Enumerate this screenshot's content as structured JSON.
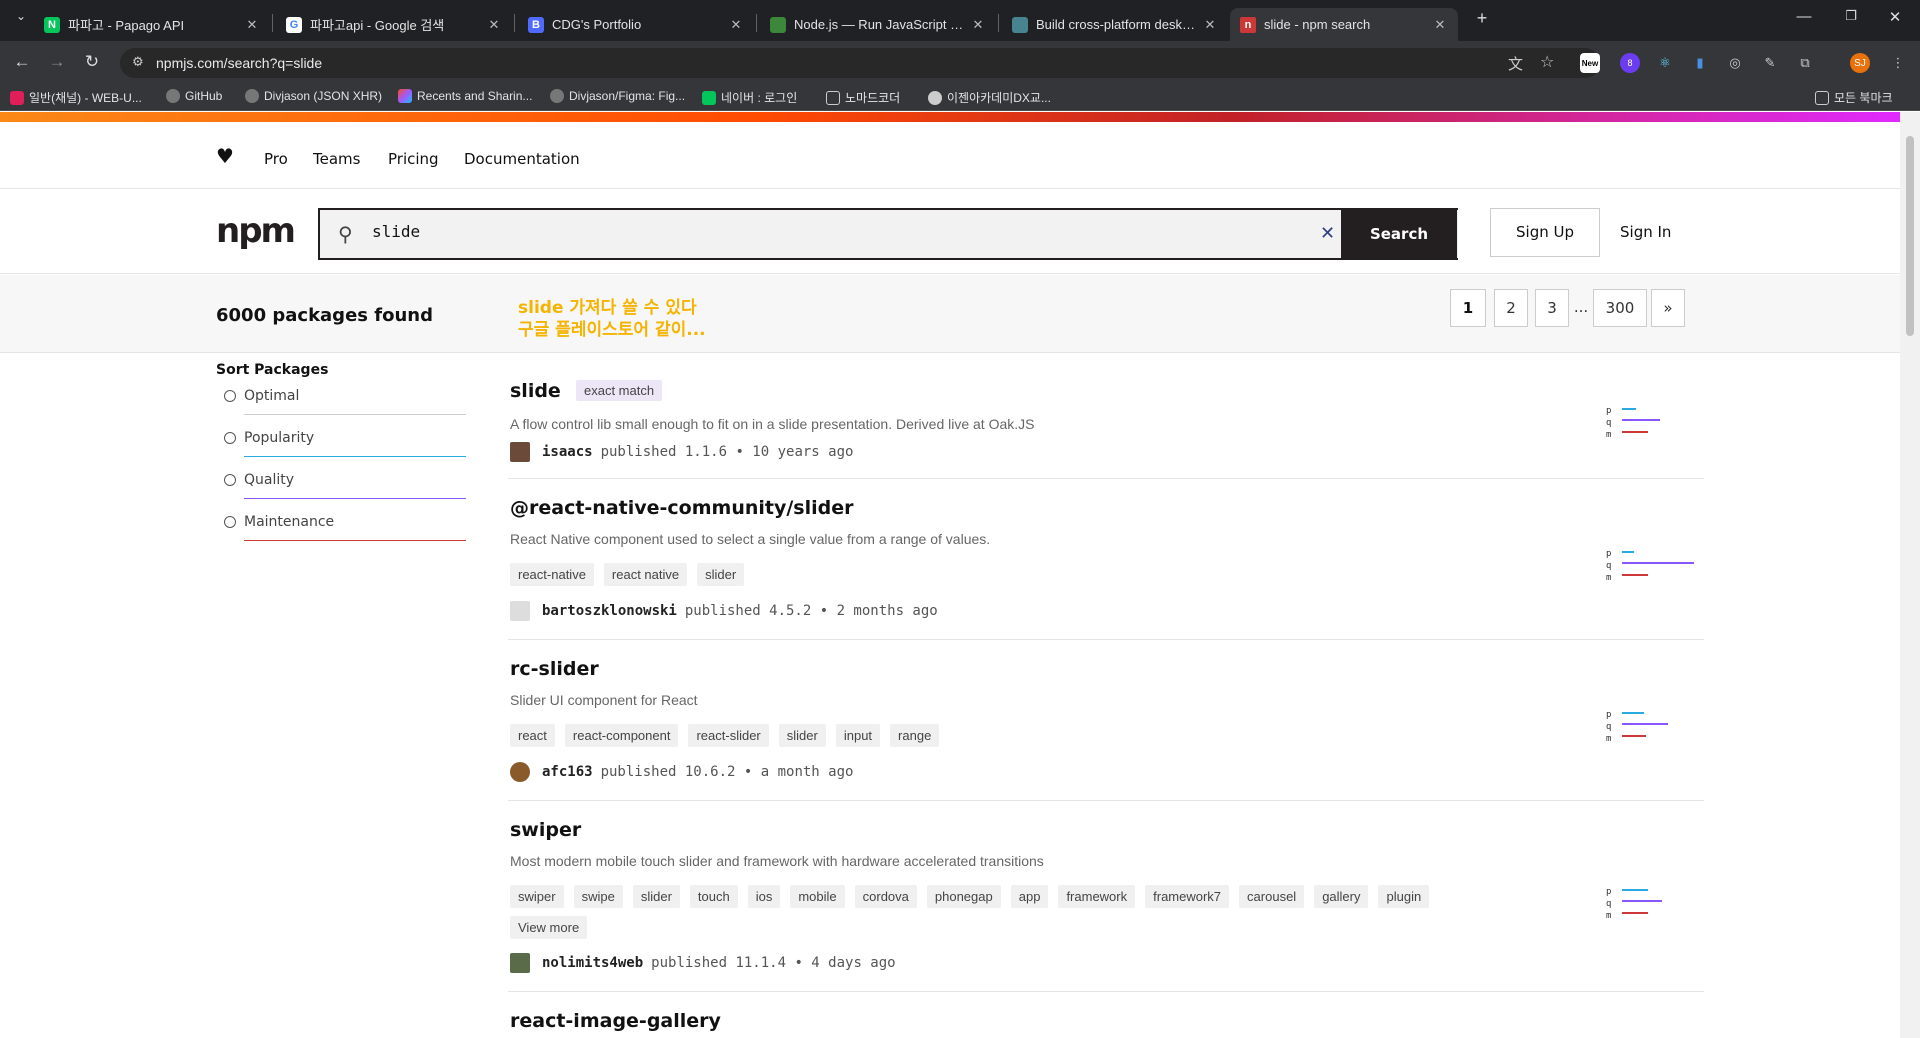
{
  "browser": {
    "tabs": [
      {
        "title": "파파고 - Papago API",
        "active": false
      },
      {
        "title": "파파고api - Google 검색",
        "active": false
      },
      {
        "title": "CDG's Portfolio",
        "active": false
      },
      {
        "title": "Node.js — Run JavaScript Ever",
        "active": false
      },
      {
        "title": "Build cross-platform desktop a",
        "active": false
      },
      {
        "title": "slide - npm search",
        "active": true
      }
    ],
    "url": "npmjs.com/search?q=slide",
    "profile_initials": "SJ",
    "new_badge": "New",
    "ext_badge": "8",
    "bookmarks": [
      "일반(채널) - WEB-U...",
      "GitHub",
      "Divjason (JSON XHR)",
      "Recents and Sharin...",
      "Divjason/Figma: Fig...",
      "네이버 : 로그인",
      "노마드코더",
      "이젠아카데미DX교..."
    ],
    "all_bookmarks": "모든 북마크"
  },
  "npm": {
    "nav": [
      "Pro",
      "Teams",
      "Pricing",
      "Documentation"
    ],
    "logo": "npm",
    "search_value": "slide",
    "search_button": "Search",
    "signup": "Sign Up",
    "signin": "Sign In",
    "count": "6000 packages found",
    "annotation_line1": "slide 가져다 쓸 수 있다",
    "annotation_line2": "구글 플레이스토어 같이...",
    "pages": [
      "1",
      "2",
      "3",
      "...",
      "300",
      "»"
    ],
    "sort_title": "Sort Packages",
    "sort_options": [
      {
        "label": "Optimal",
        "color": "#cb3837"
      },
      {
        "label": "Popularity",
        "color": "#29abe2"
      },
      {
        "label": "Quality",
        "color": "#8956ff"
      },
      {
        "label": "Maintenance",
        "color": "#cb3837"
      }
    ],
    "exact_match": "exact match",
    "packages": [
      {
        "name": "slide",
        "description": "A flow control lib small enough to fit on in a slide presentation. Derived live at Oak.JS",
        "keywords": [],
        "user": "isaacs",
        "published": "published 1.1.6 • 10 years ago"
      },
      {
        "name": "@react-native-community/slider",
        "description": "React Native component used to select a single value from a range of values.",
        "keywords": [
          "react-native",
          "react native",
          "slider"
        ],
        "user": "bartoszklonowski",
        "published": "published 4.5.2 • 2 months ago"
      },
      {
        "name": "rc-slider",
        "description": "Slider UI component for React",
        "keywords": [
          "react",
          "react-component",
          "react-slider",
          "slider",
          "input",
          "range"
        ],
        "user": "afc163",
        "published": "published 10.6.2 • a month ago"
      },
      {
        "name": "swiper",
        "description": "Most modern mobile touch slider and framework with hardware accelerated transitions",
        "keywords": [
          "swiper",
          "swipe",
          "slider",
          "touch",
          "ios",
          "mobile",
          "cordova",
          "phonegap",
          "app",
          "framework",
          "framework7",
          "carousel",
          "gallery",
          "plugin",
          "View more"
        ],
        "user": "nolimits4web",
        "published": "published 11.1.4 • 4 days ago"
      },
      {
        "name": "react-image-gallery",
        "description": "",
        "keywords": [],
        "user": "",
        "published": ""
      }
    ],
    "score_labels": [
      "p",
      "q",
      "m"
    ]
  }
}
